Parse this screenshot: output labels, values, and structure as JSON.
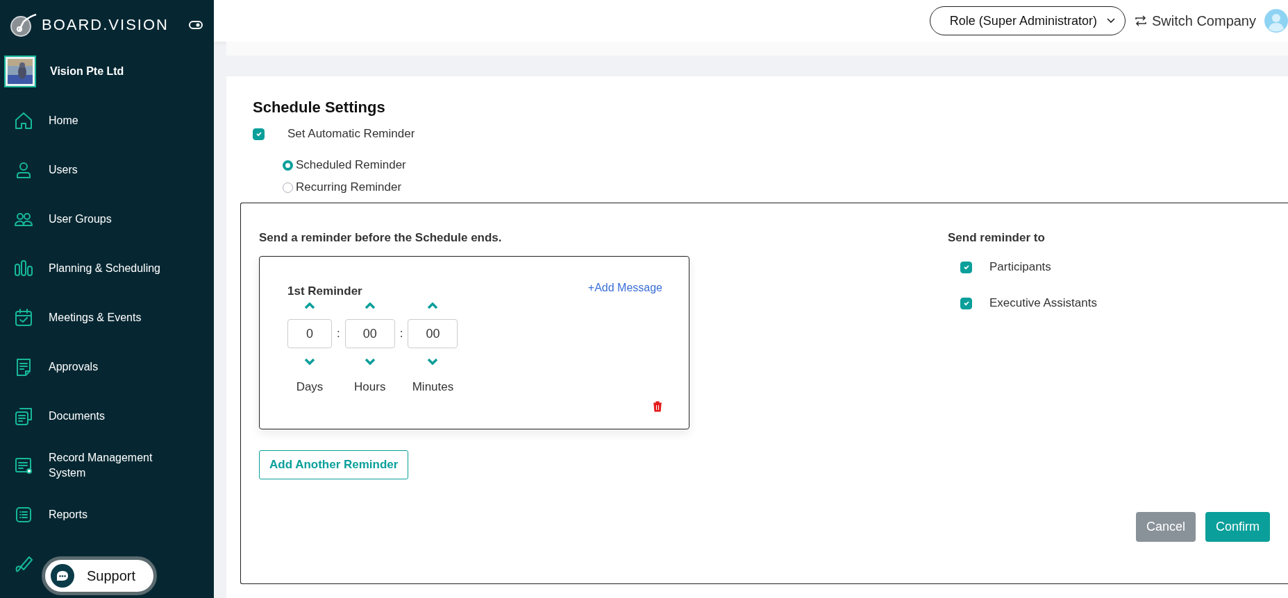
{
  "sidebar": {
    "brand": "BOARD.VISION",
    "company": "Vision Pte Ltd",
    "items": [
      {
        "label": "Home"
      },
      {
        "label": "Users"
      },
      {
        "label": "User Groups"
      },
      {
        "label": "Planning & Scheduling"
      },
      {
        "label": "Meetings & Events"
      },
      {
        "label": "Approvals"
      },
      {
        "label": "Documents"
      },
      {
        "label": "Record Management System"
      },
      {
        "label": "Reports"
      }
    ],
    "support": "Support"
  },
  "topbar": {
    "role": "Role (Super Administrator)",
    "switch": "Switch Company"
  },
  "settings": {
    "title": "Schedule Settings",
    "auto_reminder": {
      "label": "Set Automatic Reminder",
      "checked": true
    },
    "modes": [
      {
        "label": "Scheduled Reminder",
        "selected": true
      },
      {
        "label": "Recurring Reminder",
        "selected": false
      }
    ],
    "intro": "Send a reminder before the Schedule ends.",
    "reminders": [
      {
        "title": "1st Reminder",
        "add_message": "+Add Message",
        "separators": [
          ":",
          ":"
        ],
        "units": [
          {
            "value": "0",
            "label": "Days"
          },
          {
            "value": "00",
            "label": "Hours"
          },
          {
            "value": "00",
            "label": "Minutes"
          }
        ]
      }
    ],
    "add_another": "Add Another Reminder",
    "recipients_title": "Send reminder to",
    "recipients": [
      {
        "label": "Participants",
        "checked": true
      },
      {
        "label": "Executive Assistants",
        "checked": true
      }
    ],
    "buttons": [
      {
        "label": "Cancel",
        "kind": "secondary"
      },
      {
        "label": "Confirm",
        "kind": "primary"
      }
    ]
  }
}
